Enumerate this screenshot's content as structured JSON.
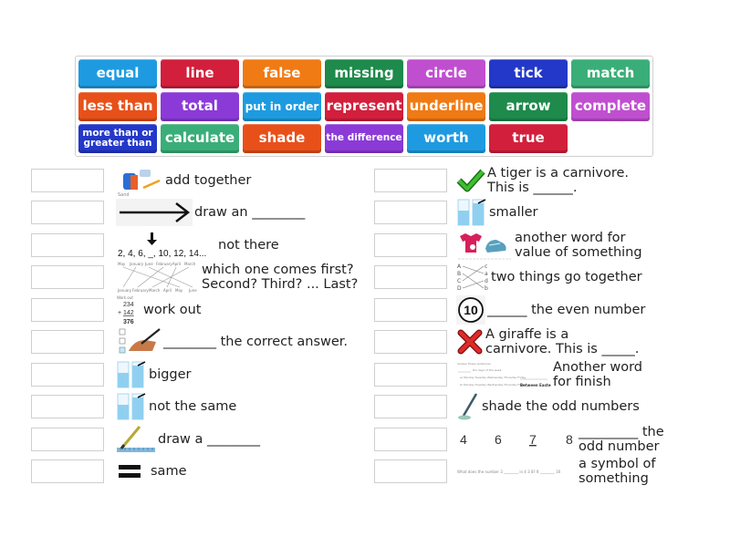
{
  "word_bank": {
    "tiles": [
      {
        "label": "equal",
        "color": "#1e9be0"
      },
      {
        "label": "line",
        "color": "#d21f3c"
      },
      {
        "label": "false",
        "color": "#f07a14"
      },
      {
        "label": "missing",
        "color": "#1e8a4c"
      },
      {
        "label": "circle",
        "color": "#c04fd0"
      },
      {
        "label": "tick",
        "color": "#2338c8"
      },
      {
        "label": "match",
        "color": "#3aae78"
      },
      {
        "label": "less than",
        "color": "#e8501a"
      },
      {
        "label": "total",
        "color": "#8b3ad8"
      },
      {
        "label": "put in order",
        "color": "#1e9be0"
      },
      {
        "label": "represent",
        "color": "#d21f3c"
      },
      {
        "label": "underline",
        "color": "#f07a14"
      },
      {
        "label": "arrow",
        "color": "#1e8a4c"
      },
      {
        "label": "complete",
        "color": "#c04fd0"
      },
      {
        "label": "more than or greater than",
        "color": "#2338c8"
      },
      {
        "label": "calculate",
        "color": "#3aae78"
      },
      {
        "label": "shade",
        "color": "#e8501a"
      },
      {
        "label": "the difference",
        "color": "#8b3ad8"
      },
      {
        "label": "worth",
        "color": "#1e9be0"
      },
      {
        "label": "true",
        "color": "#d21f3c"
      }
    ]
  },
  "left_items": [
    {
      "icon": "school-supplies-icon",
      "text": "add together"
    },
    {
      "icon": "arrow-icon",
      "text": "draw an ________"
    },
    {
      "icon": "number-sequence-icon",
      "text": "not there",
      "caption": "2, 4, 6, _, 10, 12, 14..."
    },
    {
      "icon": "month-matching-icon",
      "text": "which one comes first?\nSecond? Third? ... Last?"
    },
    {
      "icon": "sum-calculation-icon",
      "text": "work out",
      "caption_lines": [
        "234",
        "+142",
        "376"
      ]
    },
    {
      "icon": "hand-writing-checkbox-icon",
      "text": "________ the correct answer."
    },
    {
      "icon": "measuring-cylinders-icon",
      "text": "bigger"
    },
    {
      "icon": "measuring-cylinders-icon",
      "text": "not the same"
    },
    {
      "icon": "pencil-ruler-icon",
      "text": "draw a ________"
    },
    {
      "icon": "equals-sign-icon",
      "text": "same"
    }
  ],
  "right_items": [
    {
      "icon": "green-tick-icon",
      "text": "A tiger is a carnivore.\nThis is ______."
    },
    {
      "icon": "measuring-cylinders-icon",
      "text": "smaller"
    },
    {
      "icon": "shirt-and-shoe-icon",
      "text": "another word for\nvalue of something"
    },
    {
      "icon": "letter-matching-icon",
      "text": "two things go together"
    },
    {
      "icon": "circled-number-icon",
      "text": "______ the even number",
      "caption": "10"
    },
    {
      "icon": "red-cross-icon",
      "text": "A giraffe is a\ncarnivore. This is _____."
    },
    {
      "icon": "worksheet-sentences-icon",
      "text": "Another word\nfor finish"
    },
    {
      "icon": "pencil-shading-icon",
      "text": "shade the odd numbers"
    },
    {
      "icon": "number-row-icon",
      "text": "_________ the\nodd number",
      "numbers": [
        "4",
        "6",
        "7",
        "8"
      ]
    },
    {
      "icon": "worksheet-question-icon",
      "text": "a symbol of\nsomething"
    }
  ]
}
